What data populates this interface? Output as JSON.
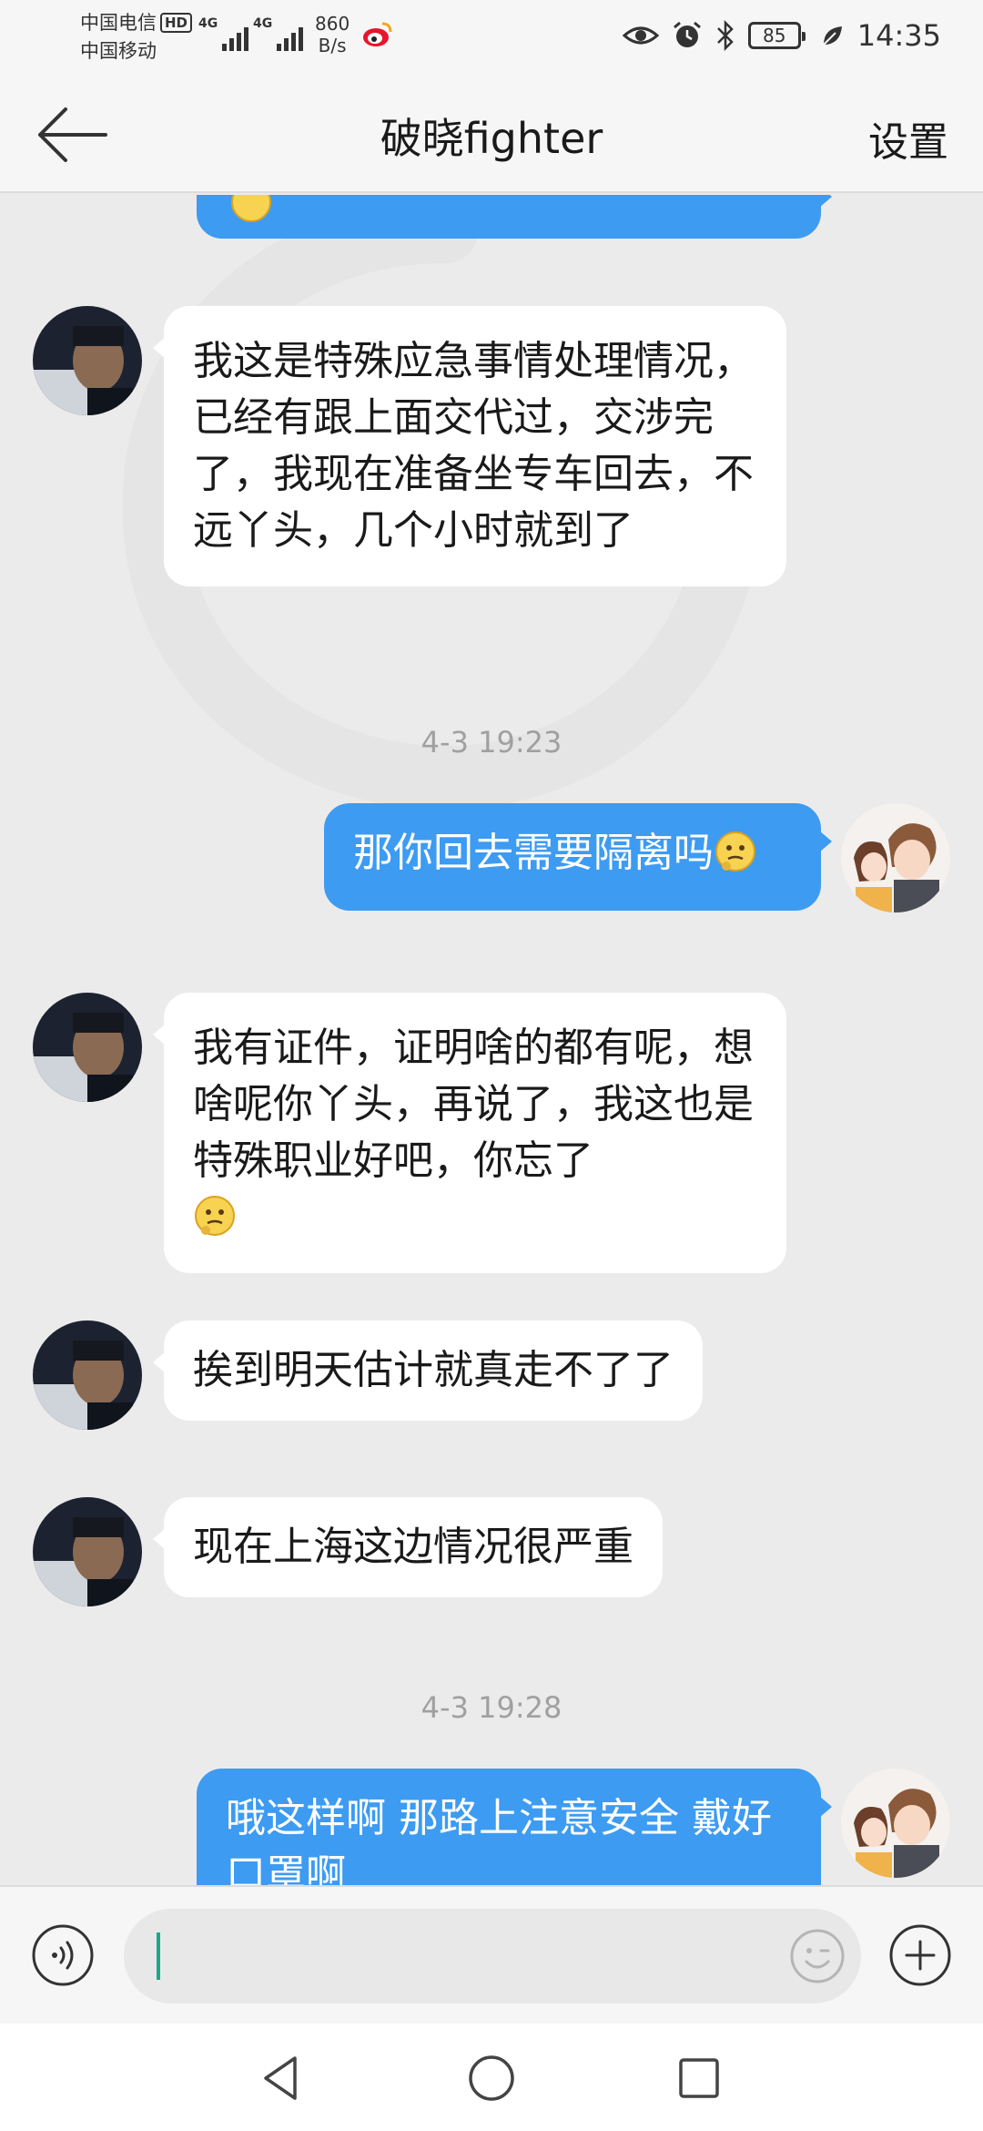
{
  "status_bar": {
    "carrier_1": "中国电信",
    "hd_badge": "HD",
    "carrier_2": "中国移动",
    "net_tag_1": "4G",
    "net_tag_2": "4G",
    "net_speed_value": "860",
    "net_speed_unit": "B/s",
    "battery": "85",
    "time": "14:35",
    "icons": [
      "weibo-icon",
      "eye-icon",
      "alarm-icon",
      "bluetooth-icon",
      "battery-icon",
      "leaf-icon"
    ]
  },
  "header": {
    "back_icon": "arrow-left-icon",
    "title": "破晓fighter",
    "settings": "设置"
  },
  "messages": [
    {
      "side": "left",
      "text": "我这是特殊应急事情处理情况，已经有跟上面交代过，交涉完了，我现在准备坐专车回去，不远丫头，几个小时就到了"
    },
    {
      "type": "timestamp",
      "text": "4-3 19:23"
    },
    {
      "side": "right",
      "text": "那你回去需要隔离吗",
      "emoji": "thinking-emoji"
    },
    {
      "side": "left",
      "text": "我有证件，证明啥的都有呢，想啥呢你丫头，再说了，我这也是特殊职业好吧，你忘了",
      "emoji": "thinking-emoji"
    },
    {
      "side": "left",
      "text": "挨到明天估计就真走不了了"
    },
    {
      "side": "left",
      "text": "现在上海这边情况很严重"
    },
    {
      "type": "timestamp",
      "text": "4-3 19:28"
    },
    {
      "side": "right",
      "text": "哦这样啊 那路上注意安全 戴好口罩啊"
    }
  ],
  "input_bar": {
    "voice_icon": "voice-wave-icon",
    "input_value": "",
    "emoji_icon": "smiley-icon",
    "plus_icon": "plus-circle-icon"
  },
  "nav_bar": {
    "icons": [
      "triangle-back-icon",
      "circle-home-icon",
      "square-recents-icon"
    ]
  },
  "colors": {
    "outgoing_bubble": "#3d9bf2",
    "incoming_bubble": "#ffffff",
    "chat_background": "#ebebeb",
    "caret": "#1aa88a"
  }
}
